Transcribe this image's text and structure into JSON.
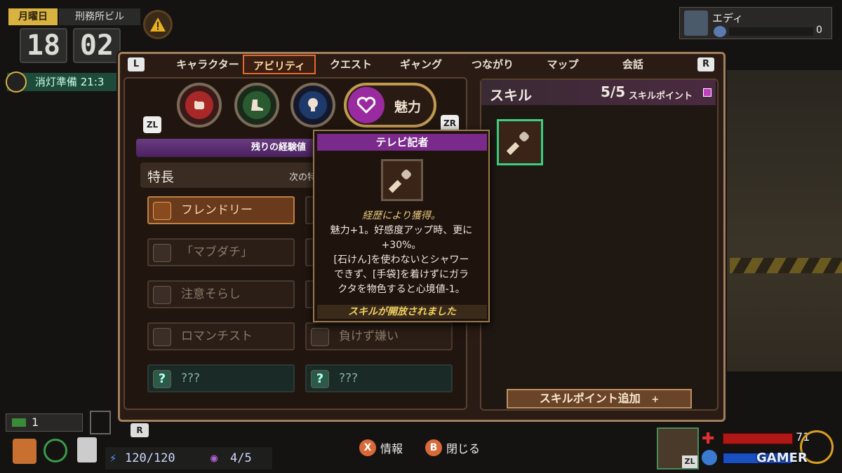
{
  "hud_top": {
    "day": "月曜日",
    "location": "刑務所ビル",
    "hour": "18",
    "minute": "02",
    "routine": "消灯準備 21:3",
    "player_name": "エディ",
    "player_money": "0"
  },
  "tabs": {
    "left_key": "L",
    "right_key": "R",
    "items": [
      "キャラクター",
      "アビリティ",
      "クエスト",
      "ギャング",
      "つながり",
      "マップ",
      "会話"
    ],
    "active": "アビリティ"
  },
  "stats": {
    "zl": "ZL",
    "zr": "ZR",
    "active_label": "魅力",
    "icons": [
      "strength-fist-icon",
      "agility-boot-icon",
      "intellect-bulb-icon",
      "charm-heart-icon"
    ],
    "colors": [
      "#a82828",
      "#2a5a30",
      "#1e3a6a",
      "#9a2aa0"
    ]
  },
  "traits": {
    "xp_label": "残りの経験値",
    "header": "特長",
    "next_label": "次の特",
    "items": [
      {
        "label": "フレンドリー",
        "selected": true
      },
      {
        "label": "「マブダチ」"
      },
      {
        "label": "注意そらし"
      },
      {
        "label": "ロマンチスト"
      },
      {
        "label": "負けず嫌い"
      },
      {
        "label": "???"
      },
      {
        "label": "???"
      }
    ],
    "unknown_mark": "?"
  },
  "skills": {
    "title": "スキル",
    "count": "5/5",
    "points_label": "スキルポイント",
    "add_button": "スキルポイント追加",
    "add_plus": "+"
  },
  "tooltip": {
    "title": "テレビ記者",
    "source": "経歴により獲得。",
    "description": "魅力+1。好感度アップ時、更に+30%。\n[石けん]を使わないとシャワーできず、[手袋]を着けずにガラクタを物色すると心境値-1。",
    "line1": "魅力+1。好感度アップ時、更に",
    "line2": "+30%。",
    "line3": "[石けん]を使わないとシャワー",
    "line4": "できず、[手袋]を着けずにガラ",
    "line5": "クタを物色すると心境値-1。",
    "footer": "スキルが開放されました"
  },
  "bottom": {
    "cash": "1",
    "energy": "120/120",
    "vision": "4/5",
    "info_key": "X",
    "info_label": "情報",
    "close_key": "B",
    "close_label": "閉じる",
    "hp": "71",
    "hp_fraction": 0.71,
    "zl": "ZL",
    "r_key": "R"
  },
  "watermark": "GAMER"
}
